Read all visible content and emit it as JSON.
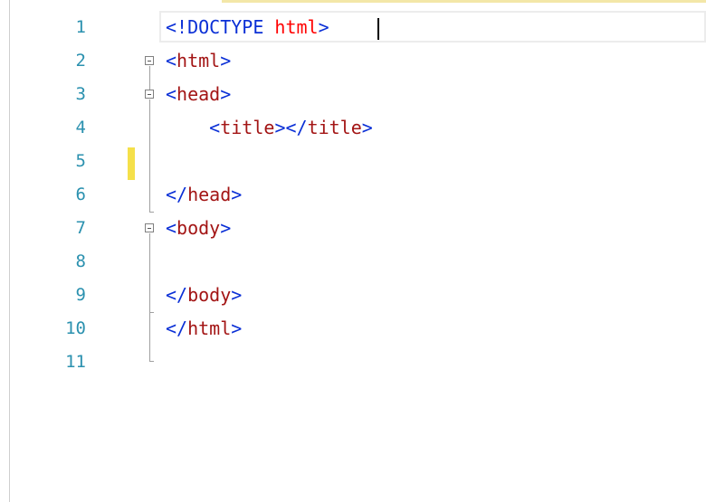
{
  "editor": {
    "line_numbers": [
      "1",
      "2",
      "3",
      "4",
      "5",
      "6",
      "7",
      "8",
      "9",
      "10",
      "11"
    ],
    "lines": [
      {
        "open": "<",
        "bang": "!DOCTYPE",
        "space": " ",
        "attr": "html",
        "close": ">"
      },
      {
        "open": "<",
        "name": "html",
        "close": ">"
      },
      {
        "open": "<",
        "name": "head",
        "close": ">"
      },
      {
        "indent": "    ",
        "open": "<",
        "name": "title",
        "mid": "></",
        "name2": "title",
        "close": ">"
      },
      {},
      {
        "open": "</",
        "name": "head",
        "close": ">"
      },
      {
        "open": "<",
        "name": "body",
        "close": ">"
      },
      {},
      {
        "open": "</",
        "name": "body",
        "close": ">"
      },
      {
        "open": "</",
        "name": "html",
        "close": ">"
      },
      {}
    ]
  },
  "colors": {
    "line_number": "#2b91af",
    "tag_delimiter": "#0a2fd6",
    "element_name": "#a31515",
    "attribute": "#ff0000",
    "change_marker": "#f5e04a"
  }
}
